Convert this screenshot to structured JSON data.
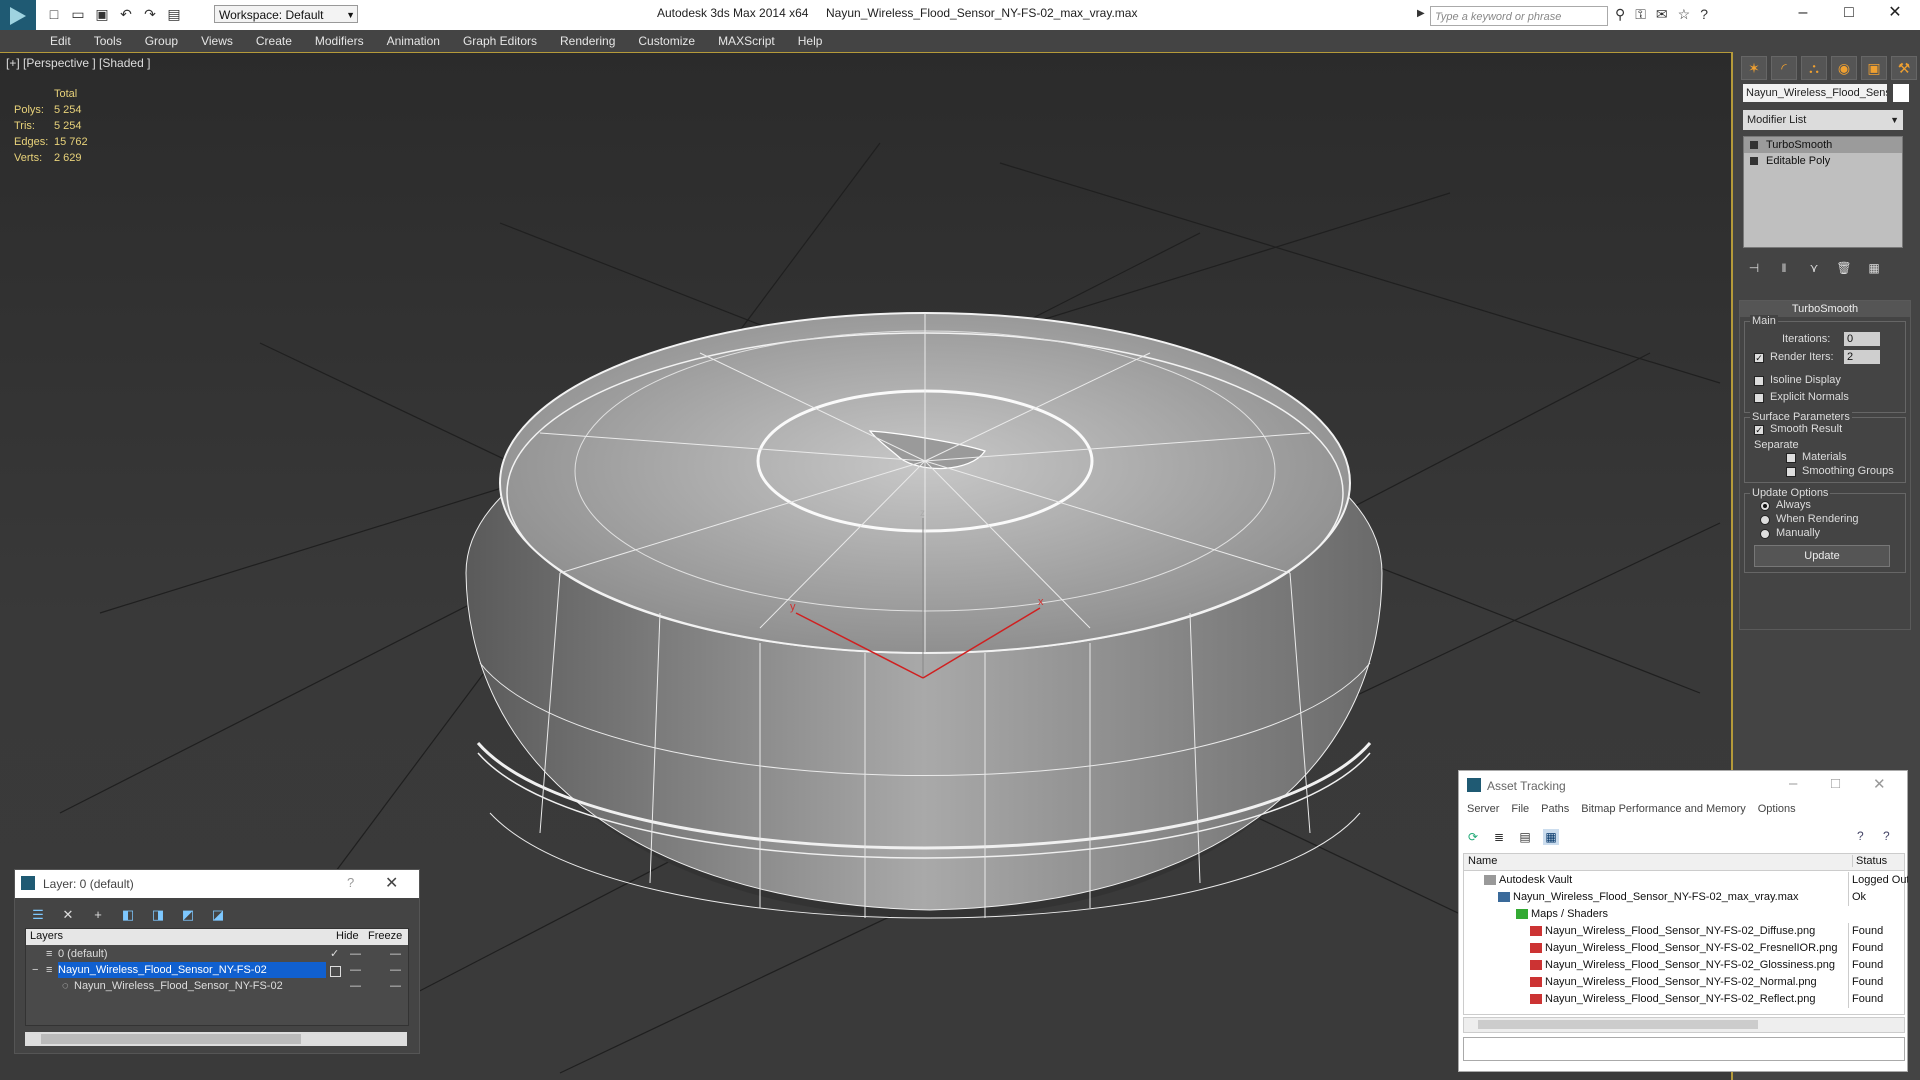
{
  "window": {
    "app_title": "Autodesk 3ds Max  2014 x64",
    "file_title": "Nayun_Wireless_Flood_Sensor_NY-FS-02_max_vray.max",
    "workspace": "Workspace: Default",
    "search_placeholder": "Type a keyword or phrase"
  },
  "menu": [
    "Edit",
    "Tools",
    "Group",
    "Views",
    "Create",
    "Modifiers",
    "Animation",
    "Graph Editors",
    "Rendering",
    "Customize",
    "MAXScript",
    "Help"
  ],
  "viewport": {
    "label": "[+] [Perspective ] [Shaded ]",
    "stats_header": "Total",
    "stats": [
      {
        "k": "Polys:",
        "v": "5 254"
      },
      {
        "k": "Tris:",
        "v": "5 254"
      },
      {
        "k": "Edges:",
        "v": "15 762"
      },
      {
        "k": "Verts:",
        "v": "2 629"
      }
    ],
    "axis": {
      "x": "x",
      "y": "y",
      "z": "z"
    }
  },
  "command_panel": {
    "object_name": "Nayun_Wireless_Flood_Sensor",
    "modifier_list": "Modifier List",
    "stack": [
      "TurboSmooth",
      "Editable Poly"
    ],
    "turbosmooth": {
      "title": "TurboSmooth",
      "main": "Main",
      "iterations_label": "Iterations:",
      "iterations_value": "0",
      "render_iters_label": "Render Iters:",
      "render_iters_value": "2",
      "isoline": "Isoline Display",
      "explicit_normals": "Explicit Normals",
      "surface_params": "Surface Parameters",
      "smooth_result": "Smooth Result",
      "separate": "Separate",
      "materials": "Materials",
      "smoothing_groups": "Smoothing Groups",
      "update_options": "Update Options",
      "always": "Always",
      "when_rendering": "When Rendering",
      "manually": "Manually",
      "update_button": "Update"
    }
  },
  "layer_dialog": {
    "title": "Layer: 0 (default)",
    "help": "?",
    "columns": {
      "layers": "Layers",
      "hide": "Hide",
      "freeze": "Freeze"
    },
    "rows": [
      {
        "name": "0 (default)",
        "check": "✓",
        "hide": "—",
        "freeze": "—"
      },
      {
        "name": "Nayun_Wireless_Flood_Sensor_NY-FS-02",
        "check": "",
        "hide": "—",
        "freeze": "—"
      },
      {
        "name": "Nayun_Wireless_Flood_Sensor_NY-FS-02",
        "check": "",
        "hide": "—",
        "freeze": "—"
      }
    ]
  },
  "asset_tracking": {
    "title": "Asset Tracking",
    "menu": [
      "Server",
      "File",
      "Paths",
      "Bitmap Performance and Memory",
      "Options"
    ],
    "columns": {
      "name": "Name",
      "status": "Status"
    },
    "rows": [
      {
        "name": "Autodesk Vault",
        "status": "Logged Out"
      },
      {
        "name": "Nayun_Wireless_Flood_Sensor_NY-FS-02_max_vray.max",
        "status": "Ok"
      },
      {
        "name": "Maps / Shaders",
        "status": ""
      },
      {
        "name": "Nayun_Wireless_Flood_Sensor_NY-FS-02_Diffuse.png",
        "status": "Found"
      },
      {
        "name": "Nayun_Wireless_Flood_Sensor_NY-FS-02_FresnelIOR.png",
        "status": "Found"
      },
      {
        "name": "Nayun_Wireless_Flood_Sensor_NY-FS-02_Glossiness.png",
        "status": "Found"
      },
      {
        "name": "Nayun_Wireless_Flood_Sensor_NY-FS-02_Normal.png",
        "status": "Found"
      },
      {
        "name": "Nayun_Wireless_Flood_Sensor_NY-FS-02_Reflect.png",
        "status": "Found"
      }
    ]
  }
}
